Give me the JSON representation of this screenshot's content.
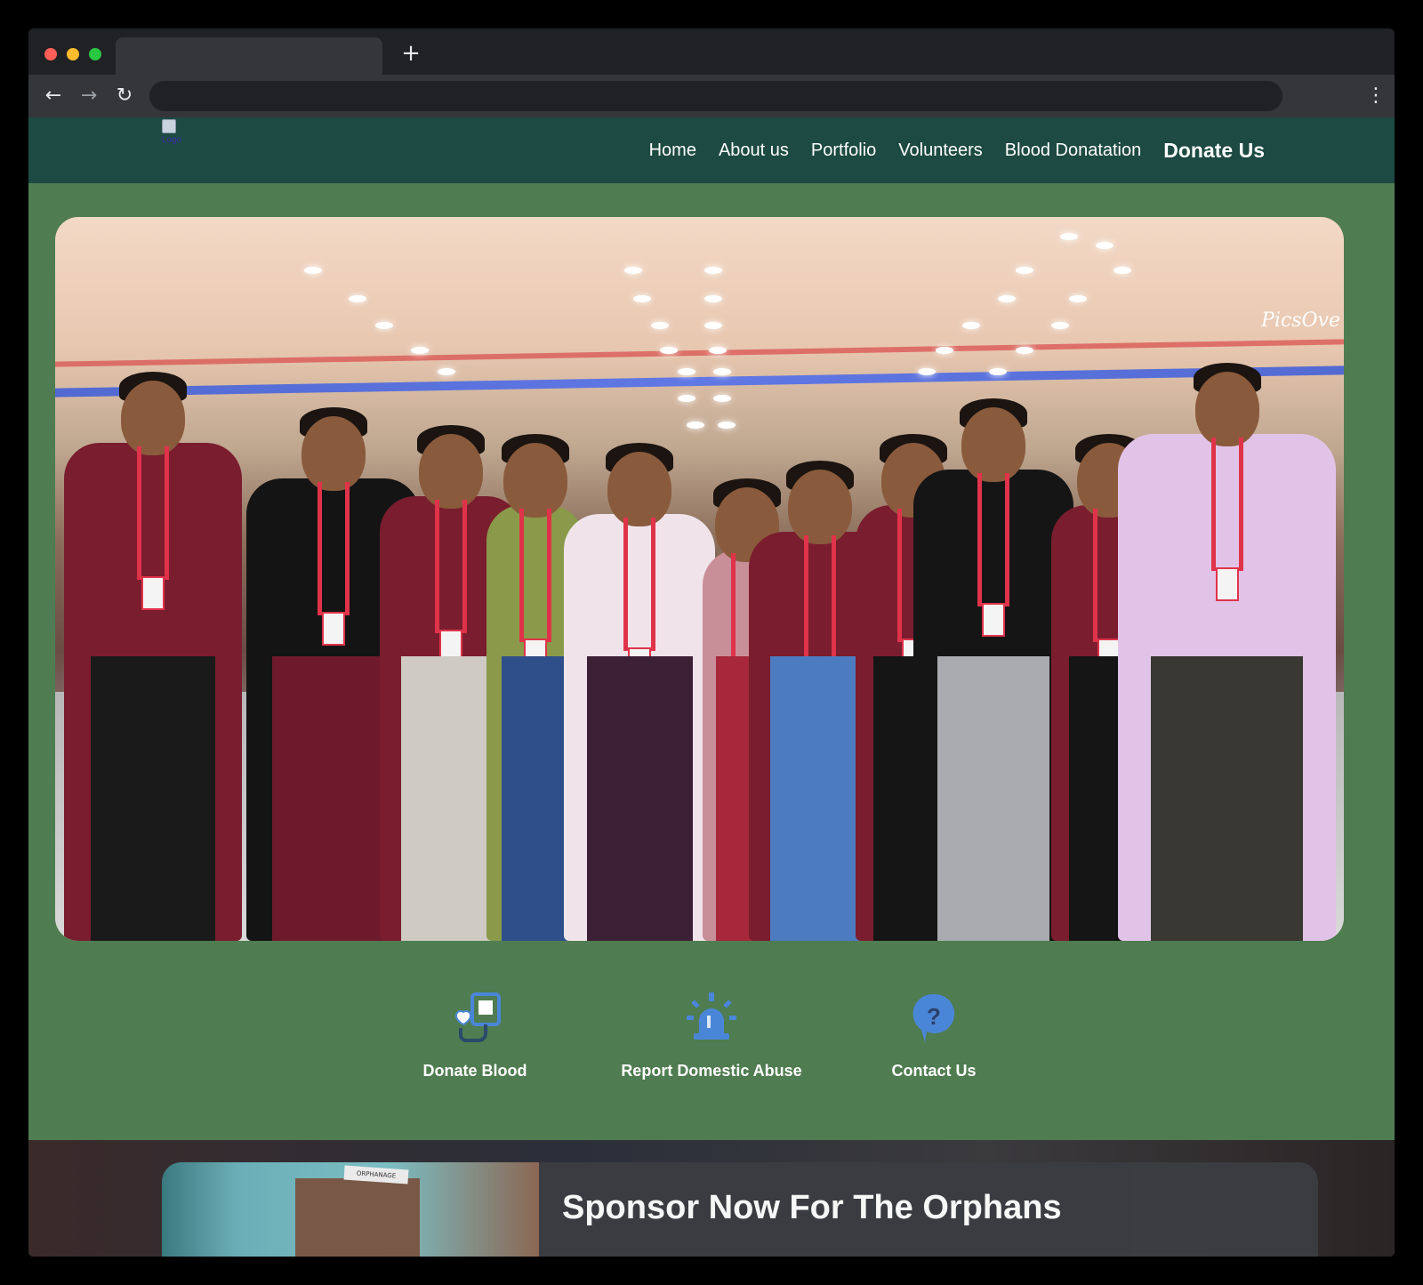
{
  "browser": {
    "tab_title": "",
    "new_tab_glyph": "+",
    "back_glyph": "←",
    "forward_glyph": "→",
    "reload_glyph": "↻",
    "menu_glyph": "⋮",
    "address": ""
  },
  "site": {
    "logo_alt": "Logo",
    "nav": [
      {
        "label": "Home"
      },
      {
        "label": "About us"
      },
      {
        "label": "Portfolio"
      },
      {
        "label": "Volunteers"
      },
      {
        "label": "Blood Donatation"
      },
      {
        "label": "Donate Us"
      }
    ],
    "hero": {
      "image_icon": "group-photo-volunteers",
      "watermark": "PicsOve"
    },
    "services": [
      {
        "label": "Donate Blood",
        "icon": "blood-donation-icon"
      },
      {
        "label": "Report Domestic Abuse",
        "icon": "alarm-siren-icon"
      },
      {
        "label": "Contact Us",
        "icon": "question-bubble-icon"
      }
    ],
    "sponsor": {
      "title": "Sponsor Now For The Orphans",
      "image_sign_text": "ORPHANAGE"
    }
  },
  "colors": {
    "nav_bg": "#1d4a42",
    "page_bg": "#4f7c50",
    "icon_blue": "#4a86d8"
  }
}
